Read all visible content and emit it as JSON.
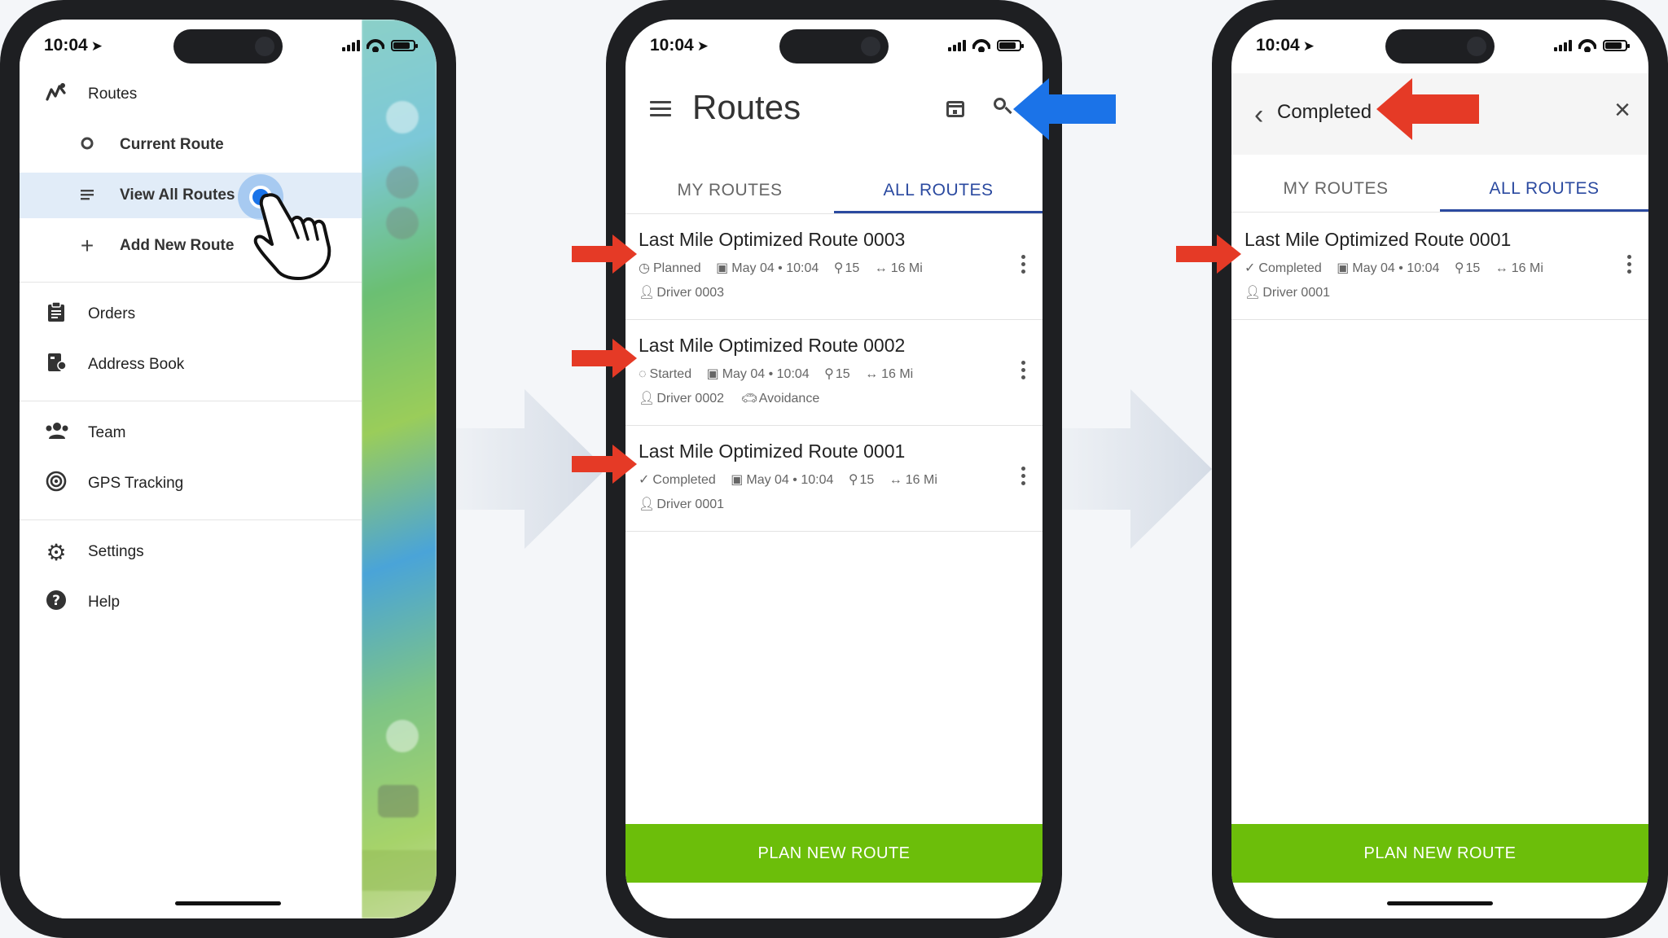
{
  "status": {
    "time": "10:04"
  },
  "menu": {
    "items": [
      {
        "label": "Routes",
        "icon": "routes-icon"
      },
      {
        "label": "Current Route",
        "icon": "circle-icon"
      },
      {
        "label": "View All Routes",
        "icon": "list-icon"
      },
      {
        "label": "Add New Route",
        "icon": "plus-icon"
      },
      {
        "label": "Orders",
        "icon": "clipboard-icon"
      },
      {
        "label": "Address Book",
        "icon": "address-book-icon"
      },
      {
        "label": "Team",
        "icon": "team-icon"
      },
      {
        "label": "GPS Tracking",
        "icon": "gps-icon"
      },
      {
        "label": "Settings",
        "icon": "gear-icon"
      },
      {
        "label": "Help",
        "icon": "help-icon"
      }
    ]
  },
  "routes_screen": {
    "title": "Routes",
    "tabs": [
      "MY ROUTES",
      "ALL ROUTES"
    ],
    "routes": [
      {
        "name": "Last Mile Optimized Route 0003",
        "status": "Planned",
        "date": "May 04 • 10:04",
        "stops": "15",
        "distance": "16 Mi",
        "driver": "Driver 0003",
        "extra": ""
      },
      {
        "name": "Last Mile Optimized Route 0002",
        "status": "Started",
        "date": "May 04 • 10:04",
        "stops": "15",
        "distance": "16 Mi",
        "driver": "Driver 0002",
        "extra": "Avoidance"
      },
      {
        "name": "Last Mile Optimized Route 0001",
        "status": "Completed",
        "date": "May 04 • 10:04",
        "stops": "15",
        "distance": "16 Mi",
        "driver": "Driver 0001",
        "extra": ""
      }
    ],
    "plan_button": "PLAN NEW ROUTE"
  },
  "search_screen": {
    "query": "Completed",
    "tabs": [
      "MY ROUTES",
      "ALL ROUTES"
    ],
    "routes": [
      {
        "name": "Last Mile Optimized Route 0001",
        "status": "Completed",
        "date": "May 04 • 10:04",
        "stops": "15",
        "distance": "16 Mi",
        "driver": "Driver 0001"
      }
    ],
    "plan_button": "PLAN NEW ROUTE"
  },
  "colors": {
    "accent": "#2b4aa0",
    "plan_button": "#6cbe0a",
    "red_arrow": "#e53a26",
    "blue_arrow": "#1b73e8",
    "highlight": "#e1ecf8"
  }
}
